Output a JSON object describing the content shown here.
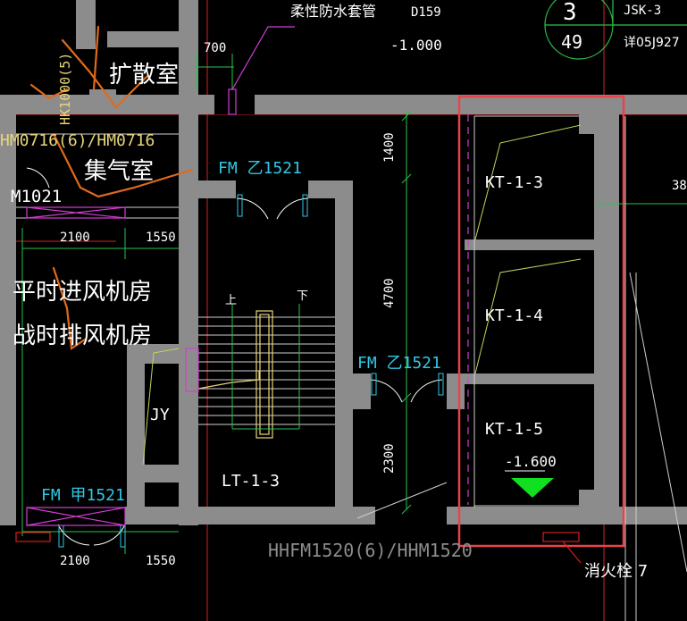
{
  "labels": {
    "pipe": "柔性防水套管",
    "pipe_code": "D159",
    "pipe_elev": "-1.000",
    "dim_700": "700",
    "circle_top": "3",
    "circle_bottom": "49",
    "jsk": "JSK-3",
    "detail": "详05J927",
    "kuosan": "扩散室",
    "hk": "HK1000(5)",
    "hm": "HM0716(6)/HM0716",
    "jiqi": "集气室",
    "m1021": "M1021",
    "dim_2100_a": "2100",
    "dim_1550_a": "1550",
    "room1": "平时进风机房",
    "room2": "战时排风机房",
    "fm_top": "FM 乙1521",
    "fm_mid": "FM 乙1521",
    "fm_bot": "FM 甲1521",
    "up": "上",
    "down": "下",
    "jy": "JY",
    "lt": "LT-1-3",
    "dim_1400": "1400",
    "dim_4700": "4700",
    "dim_2300": "2300",
    "kt3": "KT-1-3",
    "kt4": "KT-1-4",
    "kt5": "KT-1-5",
    "elev": "-1.600",
    "hhfm": "HHFM1520(6)/HHM1520",
    "hydrant": "消火栓 7",
    "dim_2100_b": "2100",
    "dim_1550_b": "1550",
    "dim_38": "38"
  },
  "colors": {
    "wall": "#8c8c8c",
    "grid_red": "#d81e1e",
    "dim_green": "#27c44a",
    "text_white": "#ffffff",
    "text_cyan": "#2fc8e6",
    "text_yellow": "#e8d57a",
    "door_magenta": "#d63cd6",
    "orange_mark": "#e06a1a",
    "highlight": "#e8434a",
    "elev_marker": "#10e020"
  }
}
